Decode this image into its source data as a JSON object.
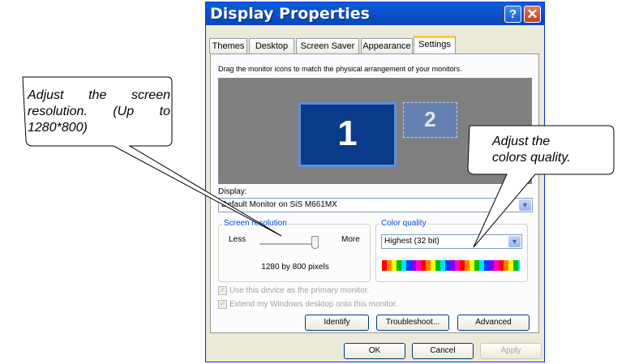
{
  "window": {
    "title": "Display Properties",
    "help_glyph": "?",
    "close_glyph": "✕"
  },
  "tabs": [
    "Themes",
    "Desktop",
    "Screen Saver",
    "Appearance",
    "Settings"
  ],
  "active_tab": "Settings",
  "settings": {
    "instruction": "Drag the monitor icons to match the physical arrangement of your monitors.",
    "monitor_1": "1",
    "monitor_2": "2",
    "display_label": "Display:",
    "display_value": "Default Monitor on SiS M661MX",
    "resolution_group": "Screen resolution",
    "less_label": "Less",
    "more_label": "More",
    "resolution_value": "1280 by 800 pixels",
    "resolution_level": 1.0,
    "color_group": "Color quality",
    "color_value": "Highest (32 bit)",
    "primary_check": "Use this device as the primary monitor.",
    "extend_check": "Extend my Windows desktop onto this monitor.",
    "identify": "Identify",
    "troubleshoot": "Troubleshoot...",
    "advanced": "Advanced"
  },
  "footer": {
    "ok": "OK",
    "cancel": "Cancel",
    "apply": "Apply"
  },
  "callouts": {
    "resolution": [
      "Adjust the screen",
      "resolution. (Up to",
      "1280*800)"
    ],
    "colors": [
      "Adjust the",
      "colors quality."
    ]
  },
  "colors": {
    "title_bar": "#0a5fd8",
    "close_button": "#d9542c",
    "monitor_primary": "#0a3a8a",
    "group_label": "#0046d5"
  }
}
